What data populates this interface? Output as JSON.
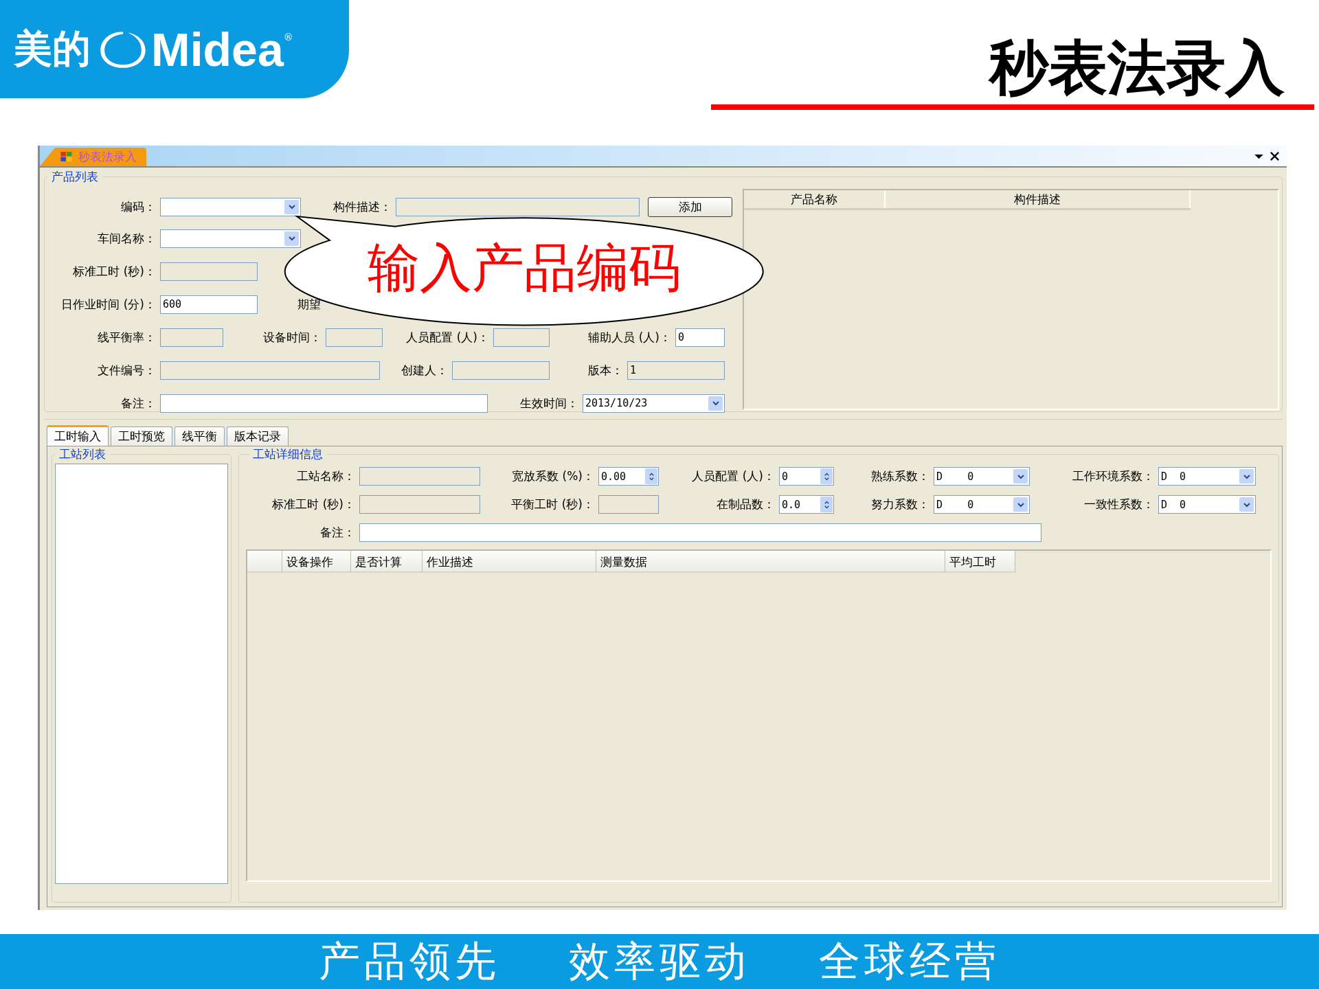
{
  "logo": {
    "chinese": "美的",
    "brand": "Midea",
    "mark": "®"
  },
  "slide_title": "秒表法录入",
  "window": {
    "tab": "秒表法录入"
  },
  "product_group": {
    "title": "产品列表",
    "add_button": "添加",
    "list_columns": [
      "产品名称",
      "构件描述"
    ],
    "rows": [
      {
        "fields": [
          {
            "label": "编码：",
            "kind": "combo",
            "disabled": false
          },
          {
            "label": "构件描述：",
            "kind": "text",
            "disabled": true
          }
        ]
      },
      {
        "fields": [
          {
            "label": "车间名称：",
            "kind": "combo",
            "disabled": false
          }
        ]
      },
      {
        "fields": [
          {
            "label": "标准工时 (秒)：",
            "kind": "text",
            "disabled": true
          }
        ]
      },
      {
        "fields": [
          {
            "label": "日作业时间 (分)：",
            "kind": "text",
            "value": "600",
            "disabled": false
          },
          {
            "label": "期望",
            "kind": "label"
          }
        ]
      },
      {
        "fields": [
          {
            "label": "线平衡率：",
            "kind": "text",
            "disabled": true
          },
          {
            "label": "设备时间：",
            "kind": "text",
            "disabled": true
          },
          {
            "label": "人员配置 (人)：",
            "kind": "text",
            "disabled": true
          },
          {
            "label": "辅助人员 (人)：",
            "kind": "text",
            "value": "0",
            "disabled": false
          }
        ]
      },
      {
        "fields": [
          {
            "label": "文件编号：",
            "kind": "text",
            "disabled": true
          },
          {
            "label": "创建人：",
            "kind": "text",
            "disabled": true
          },
          {
            "label": "版本：",
            "kind": "text",
            "value": "1",
            "disabled": true
          }
        ]
      },
      {
        "fields": [
          {
            "label": "备注：",
            "kind": "text",
            "disabled": false
          },
          {
            "label": "生效时间：",
            "kind": "combo",
            "value": "2013/10/23",
            "disabled": false
          }
        ]
      }
    ]
  },
  "callout": "输入产品编码",
  "tabs": [
    {
      "label": "工时输入",
      "selected": true
    },
    {
      "label": "工时预览",
      "selected": false
    },
    {
      "label": "线平衡",
      "selected": false
    },
    {
      "label": "版本记录",
      "selected": false
    }
  ],
  "station_list": {
    "title": "工站列表"
  },
  "station_detail": {
    "title": "工站详细信息",
    "grid_columns": [
      "设备操作",
      "是否计算",
      "作业描述",
      "测量数据",
      "平均工时"
    ],
    "rows": [
      {
        "fields": [
          {
            "label": "工站名称：",
            "kind": "text",
            "disabled": true
          },
          {
            "label": "宽放系数 (%)：",
            "kind": "spin",
            "value": "0.00",
            "disabled": false
          },
          {
            "label": "人员配置 (人)：",
            "kind": "spin",
            "value": "0",
            "disabled": false
          },
          {
            "label": "熟练系数：",
            "kind": "combo",
            "value": "D    0",
            "disabled": false
          },
          {
            "label": "工作环境系数：",
            "kind": "combo",
            "value": "D  0",
            "disabled": false
          }
        ]
      },
      {
        "fields": [
          {
            "label": "标准工时 (秒)：",
            "kind": "text",
            "disabled": true
          },
          {
            "label": "平衡工时 (秒)：",
            "kind": "text",
            "disabled": true
          },
          {
            "label": "在制品数：",
            "kind": "spin",
            "value": "0.0",
            "disabled": false
          },
          {
            "label": "努力系数：",
            "kind": "combo",
            "value": "D    0",
            "disabled": false
          },
          {
            "label": "一致性系数：",
            "kind": "combo",
            "value": "D  0",
            "disabled": false
          }
        ]
      },
      {
        "fields": [
          {
            "label": "备注：",
            "kind": "text",
            "disabled": false
          }
        ]
      }
    ]
  },
  "footer": [
    "产品领先",
    "效率驱动",
    "全球经营"
  ]
}
